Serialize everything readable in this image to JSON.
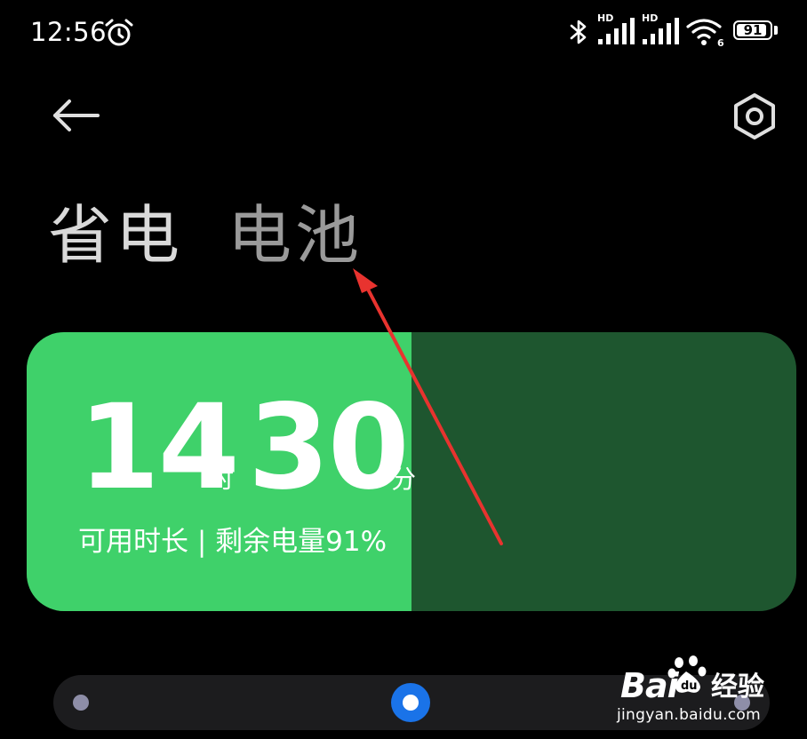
{
  "status_bar": {
    "time": "12:56",
    "network_1_label": "HD",
    "network_2_label": "HD",
    "wifi_badge": "6",
    "battery_percent": "91",
    "battery_level": 0.91
  },
  "nav": {
    "back_icon": "back-arrow-icon",
    "settings_icon": "hexagon-gear-icon"
  },
  "tabs": [
    {
      "label": "省电",
      "active": true
    },
    {
      "label": "电池",
      "active": false
    }
  ],
  "battery_card": {
    "hours": "14",
    "hours_unit": "时",
    "minutes": "30",
    "minutes_unit": "分",
    "subtitle": "可用时长 | 剩余电量91%",
    "charge_level": 0.5,
    "fill_color": "#3fd16a",
    "track_color": "#1e562f"
  },
  "mode_slider": {
    "positions": 3,
    "selected_index": 1,
    "accent_color": "#1a73e8"
  },
  "annotation": {
    "color": "#e8332f"
  },
  "watermark": {
    "brand": "Bai",
    "suffix": "经验",
    "url": "jingyan.baidu.com"
  }
}
